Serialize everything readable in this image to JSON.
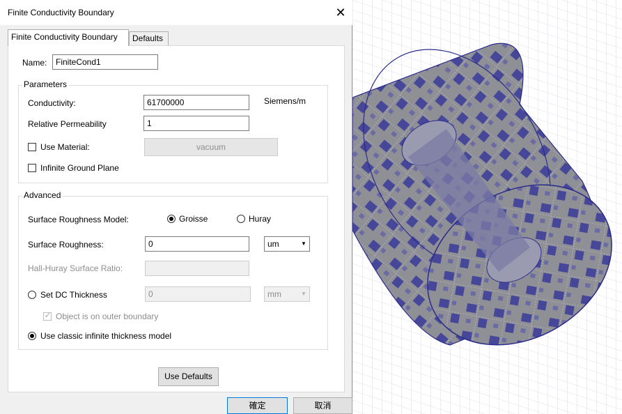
{
  "window": {
    "title": "Finite Conductivity Boundary"
  },
  "tabs": [
    {
      "label": "Finite Conductivity Boundary",
      "active": true
    },
    {
      "label": "Defaults",
      "active": false
    }
  ],
  "name": {
    "label": "Name:",
    "value": "FiniteCond1"
  },
  "parameters": {
    "group_label": "Parameters",
    "conductivity": {
      "label": "Conductivity:",
      "value": "61700000",
      "unit": "Siemens/m"
    },
    "relative_permeability": {
      "label": "Relative Permeability",
      "value": "1"
    },
    "use_material": {
      "label": "Use Material:",
      "checked": false,
      "button_label": "vacuum"
    },
    "infinite_ground_plane": {
      "label": "Infinite Ground Plane",
      "checked": false
    }
  },
  "advanced": {
    "group_label": "Advanced",
    "roughness_model": {
      "label": "Surface Roughness Model:",
      "options": [
        "Groisse",
        "Huray"
      ],
      "selected": "Groisse"
    },
    "surface_roughness": {
      "label": "Surface Roughness:",
      "value": "0",
      "unit": "um"
    },
    "hall_huray": {
      "label": "Hall-Huray Surface Ratio:",
      "value": ""
    },
    "dc_thickness": {
      "label": "Set DC Thickness",
      "value": "0",
      "unit": "mm"
    },
    "outer_boundary": {
      "label": "Object is on outer boundary",
      "checked": true
    },
    "classic_model": {
      "label": "Use classic infinite thickness model",
      "selected": true
    }
  },
  "buttons": {
    "use_defaults": "Use Defaults",
    "ok": "確定",
    "cancel": "取消"
  },
  "colors": {
    "mesh": "#2a2a8c",
    "surface": "#8c8c8c",
    "accent": "#0078d7"
  }
}
